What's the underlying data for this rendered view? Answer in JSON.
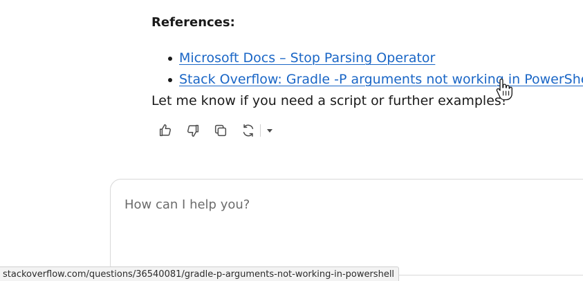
{
  "references": {
    "heading": "References:",
    "links": [
      {
        "label": "Microsoft Docs – Stop Parsing Operator"
      },
      {
        "label": "Stack Overflow: Gradle -P arguments not working in PowerShell"
      }
    ]
  },
  "closing_text": "Let me know if you need a script or further examples!",
  "actions": {
    "icons": [
      "thumbs-up-icon",
      "thumbs-down-icon",
      "copy-icon",
      "regenerate-icon",
      "chevron-down-icon"
    ]
  },
  "chat_input": {
    "placeholder": "How can I help you?",
    "value": ""
  },
  "status_bar": {
    "url": "stackoverflow.com/questions/36540081/gradle-p-arguments-not-working-in-powershell"
  },
  "colors": {
    "link": "#1a66c6",
    "text": "#1a1a1a",
    "placeholder": "#6b6b6b",
    "icon": "#4a4a4a"
  }
}
